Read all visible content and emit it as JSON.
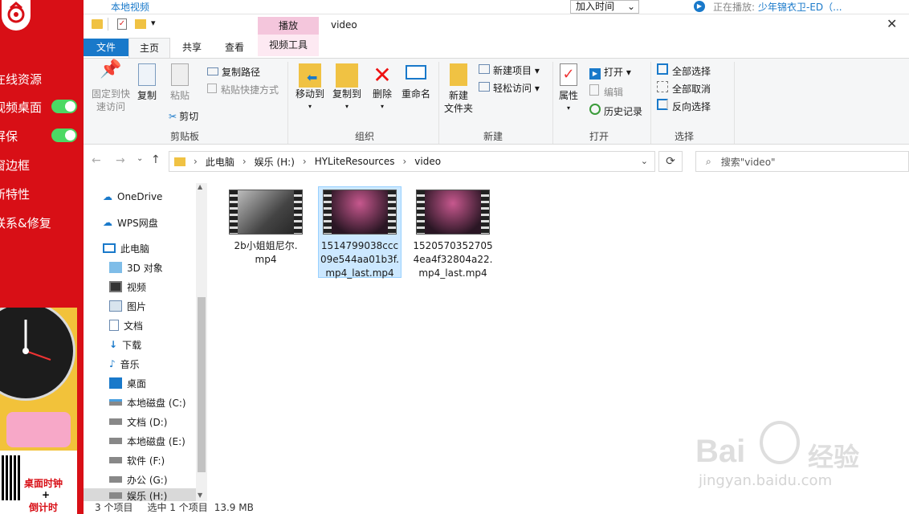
{
  "topbar": {
    "local_video": "本地视频",
    "add_time": "加入时间",
    "now_playing": "正在播放:",
    "song": "少年锦衣卫-ED（..."
  },
  "leftapp": {
    "items": [
      "在线资源",
      "视频桌面",
      "屏保",
      "窗边框",
      "新特性",
      "联系&修复"
    ],
    "promo_line1": "桌面时钟",
    "promo_plus": "+",
    "promo_line2": "倒计时"
  },
  "window": {
    "title": "video",
    "qat_dropdown": "▾",
    "tabs": {
      "file": "文件",
      "home": "主页",
      "share": "共享",
      "view": "查看",
      "play_context": "播放",
      "video_tools": "视频工具"
    },
    "ribbon": {
      "pin_quick": [
        "固定到快",
        "速访问"
      ],
      "copy": "复制",
      "paste": "粘贴",
      "copy_path": "复制路径",
      "paste_shortcut": "粘贴快捷方式",
      "cut": "剪切",
      "clipboard_group": "剪贴板",
      "move_to": "移动到",
      "copy_to": "复制到",
      "delete": "删除",
      "rename": "重命名",
      "organize_group": "组织",
      "new_folder": [
        "新建",
        "文件夹"
      ],
      "new_item": "新建项目",
      "easy_access": "轻松访问",
      "new_group": "新建",
      "properties": "属性",
      "open": "打开",
      "edit": "编辑",
      "history": "历史记录",
      "open_group": "打开",
      "select_all": "全部选择",
      "select_none": "全部取消",
      "invert_selection": "反向选择",
      "select_group": "选择"
    },
    "address": {
      "crumbs": [
        "此电脑",
        "娱乐 (H:)",
        "HYLiteResources",
        "video"
      ],
      "search_placeholder": "搜索\"video\""
    },
    "nav": [
      "OneDrive",
      "WPS网盘",
      "此电脑",
      "3D 对象",
      "视频",
      "图片",
      "文档",
      "下载",
      "音乐",
      "桌面",
      "本地磁盘 (C:)",
      "文档 (D:)",
      "本地磁盘 (E:)",
      "软件 (F:)",
      "办公 (G:)",
      "娱乐 (H:)"
    ],
    "files": [
      {
        "name": [
          "2b小姐姐尼尔.",
          "mp4"
        ]
      },
      {
        "name": [
          "1514799038ccc",
          "09e544aa01b3f.",
          "mp4_last.mp4"
        ]
      },
      {
        "name": [
          "1520570352705",
          "4ea4f32804a22.",
          "mp4_last.mp4"
        ]
      }
    ],
    "status": {
      "count": "3 个项目",
      "selected": "选中 1 个项目",
      "size": "13.9 MB"
    }
  },
  "watermark": {
    "brand": "Bai",
    "brand2": "经验",
    "url": "jingyan.baidu.com"
  },
  "colors": {
    "accent": "#1979ca",
    "app_red": "#d80f16",
    "play_tab": "#f4c6dc",
    "selection": "#cce8ff"
  }
}
